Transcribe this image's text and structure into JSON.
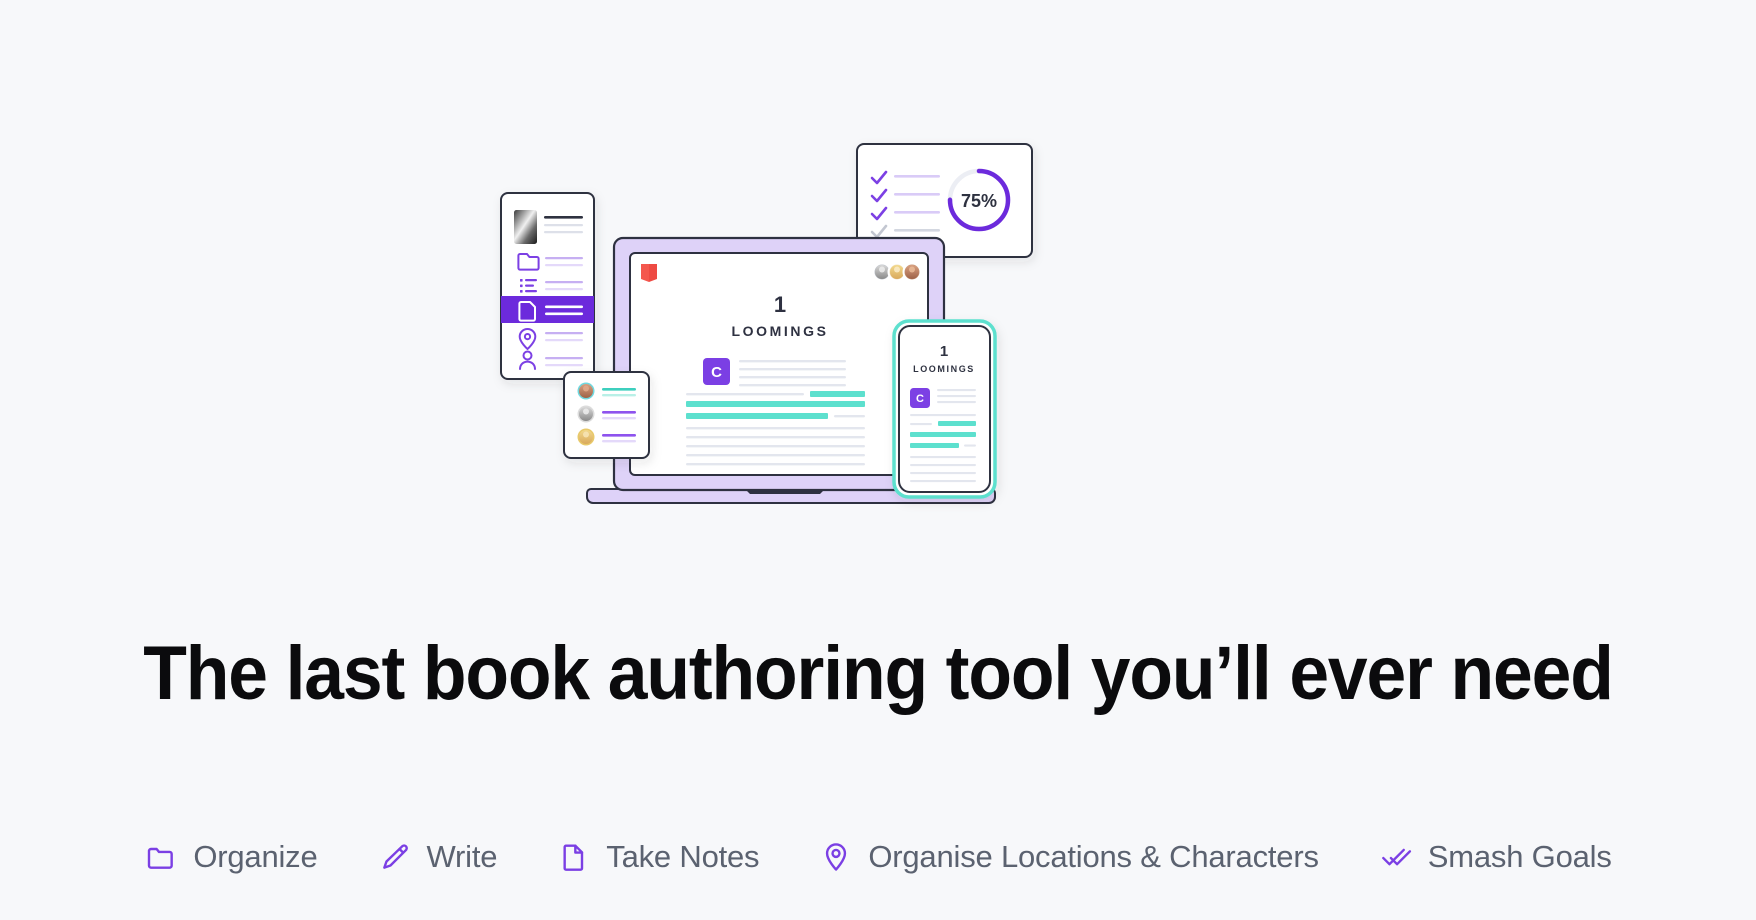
{
  "page": {
    "background_color": "#F7F8FA",
    "headline": "The last book authoring tool you’ll ever need"
  },
  "colors": {
    "accent_purple": "#7B3FE4",
    "accent_purple_deep": "#6C2BDC",
    "accent_purple_light": "#D9CBF7",
    "accent_purple_pale": "#EADFFB",
    "accent_teal": "#5DE0CE",
    "accent_teal_pale": "#B9F0E7",
    "laptop_body": "#DED2F8",
    "outline_dark": "#2E3141",
    "text_gray": "#5B6270",
    "book_red": "#F4574E",
    "line_gray": "#E3E6EE",
    "background": "#F7F8FA"
  },
  "illustration": {
    "name": "multi-device-book-authoring-mockup",
    "sidebar_card": {
      "name": "navigation-sidebar-card",
      "cover_thumbnail": "book-cover-thumbnail",
      "items": [
        {
          "icon": "folder-icon",
          "active": false
        },
        {
          "icon": "list-icon",
          "active": false
        },
        {
          "icon": "document-icon",
          "active": true
        },
        {
          "icon": "location-pin-icon",
          "active": false
        },
        {
          "icon": "person-icon",
          "active": false
        }
      ]
    },
    "collaborators_card": {
      "name": "collaborators-card",
      "rows": [
        {
          "avatar": "avatar-collaborator-1",
          "accent": "#5DE0CE"
        },
        {
          "avatar": "avatar-collaborator-2",
          "accent": "#7B3FE4"
        },
        {
          "avatar": "avatar-collaborator-3",
          "accent": "#7B3FE4"
        }
      ]
    },
    "laptop": {
      "name": "laptop-device",
      "book_icon": "book-icon",
      "avatars": [
        "avatar-editor-1",
        "avatar-editor-2",
        "avatar-editor-3"
      ],
      "chapter_number": "1",
      "chapter_title": "LOOMINGS",
      "dropcap": "C"
    },
    "phone": {
      "name": "phone-device",
      "chapter_number": "1",
      "chapter_title": "LOOMINGS",
      "dropcap": "C"
    },
    "progress_card": {
      "name": "goals-progress-card",
      "percent_label": "75%",
      "percent_value": 75,
      "checklist": [
        {
          "checked": true
        },
        {
          "checked": true
        },
        {
          "checked": true
        },
        {
          "checked": false
        }
      ]
    }
  },
  "features": [
    {
      "icon": "folder-icon",
      "label": "Organize"
    },
    {
      "icon": "pencil-icon",
      "label": "Write"
    },
    {
      "icon": "document-icon",
      "label": "Take Notes"
    },
    {
      "icon": "location-pin-icon",
      "label": "Organise Locations & Characters"
    },
    {
      "icon": "double-check-icon",
      "label": "Smash Goals"
    }
  ]
}
